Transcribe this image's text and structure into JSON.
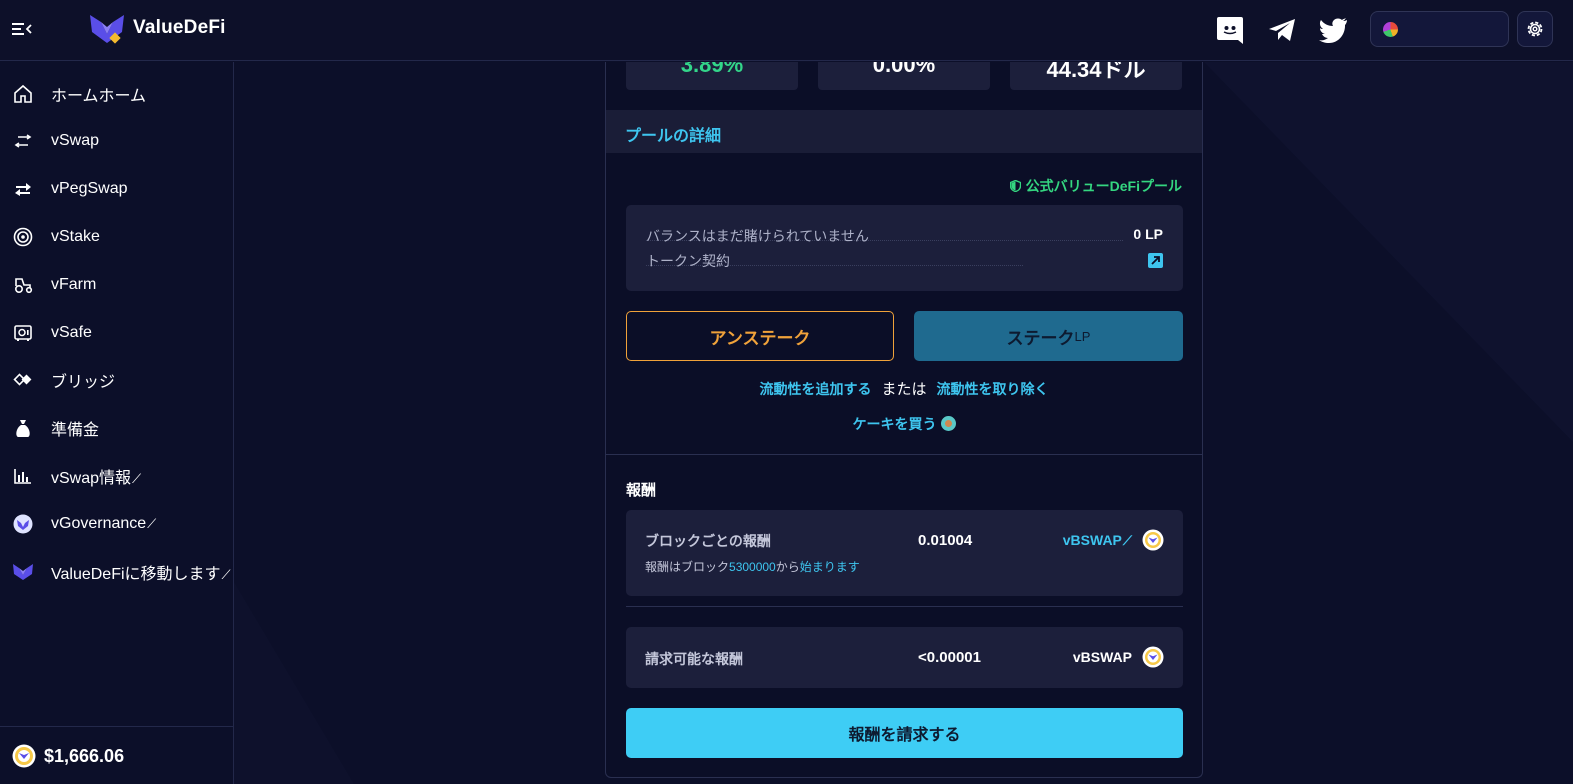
{
  "header": {
    "brand": "ValueDeFi",
    "social": [
      "discord-icon",
      "telegram-icon",
      "twitter-icon"
    ]
  },
  "sidebar": {
    "items": [
      {
        "label": "ホームホーム",
        "icon": "home-icon",
        "external": false
      },
      {
        "label": "vSwap",
        "icon": "swap-arrows-icon",
        "external": false
      },
      {
        "label": "vPegSwap",
        "icon": "peg-swap-icon",
        "external": false
      },
      {
        "label": "vStake",
        "icon": "target-icon",
        "external": false
      },
      {
        "label": "vFarm",
        "icon": "tractor-icon",
        "external": false
      },
      {
        "label": "vSafe",
        "icon": "safe-icon",
        "external": false
      },
      {
        "label": "ブリッジ",
        "icon": "bridge-icon",
        "external": false
      },
      {
        "label": "準備金",
        "icon": "money-bag-icon",
        "external": false
      },
      {
        "label": "vSwap情報",
        "icon": "bar-chart-icon",
        "external": true
      },
      {
        "label": "vGovernance",
        "icon": "governance-icon",
        "external": true
      },
      {
        "label": "ValueDeFiに移動します",
        "icon": "valuedefi-logo-icon",
        "external": true
      }
    ],
    "external_mark": "⟋",
    "price": "$1,666.06"
  },
  "stats": {
    "apy": "3.89%",
    "share": "0.00%",
    "tvl": "44.34ドル"
  },
  "pool_details": {
    "title": "プールの詳細",
    "official_label": "公式バリューDeFiプール",
    "balance_label": "バランスはまだ賭けられていません",
    "balance_value": "0 LP",
    "token_contract_label": "トークン契約"
  },
  "actions": {
    "unstake": "アンステーク",
    "stake": "ステーク",
    "stake_suffix": "LP",
    "add_liquidity": "流動性を追加する",
    "or": "または",
    "remove_liquidity": "流動性を取り除く",
    "buy_cake": "ケーキを買う"
  },
  "rewards": {
    "title": "報酬",
    "per_block_label": "ブロックごとの報酬",
    "per_block_value": "0.01004",
    "per_block_token": "vBSWAP",
    "start_prefix": "報酬はブロック",
    "start_block": "5300000",
    "start_from": "から",
    "start_suffix": "始まります",
    "claimable_label": "請求可能な報酬",
    "claimable_value": "<0.00001",
    "claimable_token": "vBSWAP",
    "claim_button": "報酬を請求する"
  },
  "colors": {
    "accent": "#3ec5ef",
    "unstake": "#f0a23a",
    "stake": "#1f6a8f",
    "official": "#34d680",
    "background": "#0c0f29"
  }
}
